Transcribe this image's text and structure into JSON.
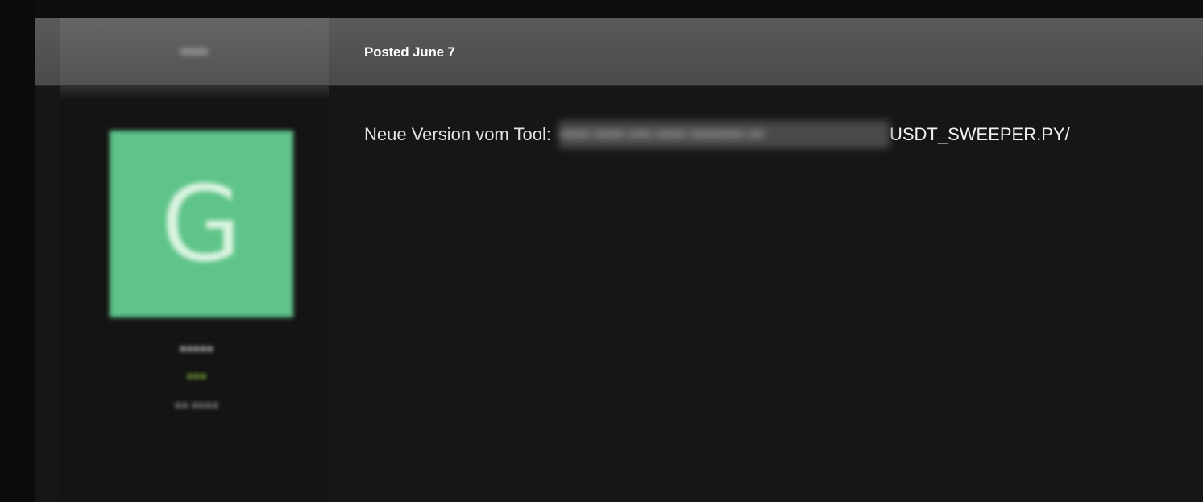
{
  "header": {
    "author_name_blurred": "●●●●",
    "posted_label": "Posted June 7"
  },
  "author": {
    "avatar_letter": "G",
    "avatar_color": "#5fc48a",
    "name_blurred": "●●●●●",
    "group_blurred": "●●●",
    "count_blurred": "●● ●●●●"
  },
  "post": {
    "text": "Neue Version vom Tool:",
    "redacted_link_placeholder": "●●●● ●●●● ●●● ●●●● ●●●●●●● ●●",
    "link_visible_tail": "USDT_SWEEPER.PY/"
  }
}
